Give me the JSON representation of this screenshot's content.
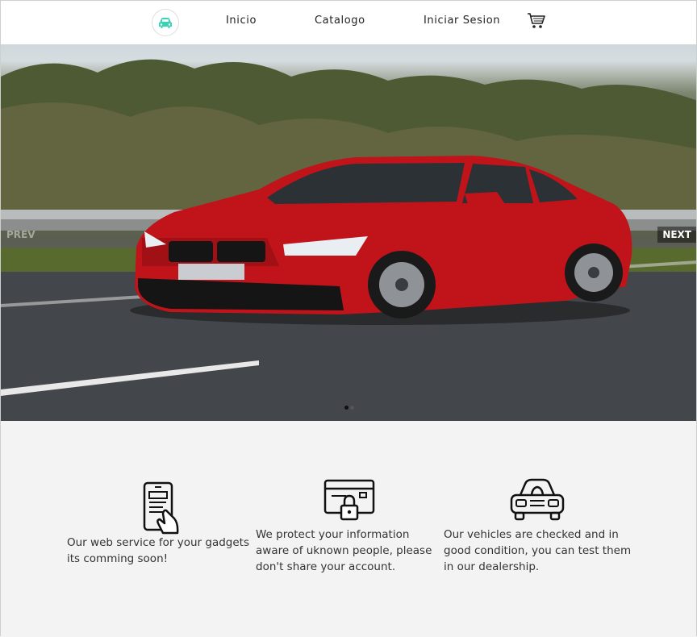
{
  "nav": {
    "logo_icon": "car-icon",
    "links": [
      "Inicio",
      "Catalogo",
      "Iniciar Sesion"
    ],
    "cart_icon": "shopping-cart-icon",
    "accent": "#39d3b6"
  },
  "slider": {
    "prev_label": "PREV",
    "next_label": "NEXT",
    "slide_count": 2,
    "active_index": 0
  },
  "features": [
    {
      "icon": "smartphone-icon",
      "text": "Our web service for your gadgets its comming soon!"
    },
    {
      "icon": "card-lock-icon",
      "text": "We protect your information aware of uknown people, please don't share your account."
    },
    {
      "icon": "car-front-icon",
      "text": "Our vehicles are checked and in good condition, you can test them in our dealership."
    }
  ]
}
